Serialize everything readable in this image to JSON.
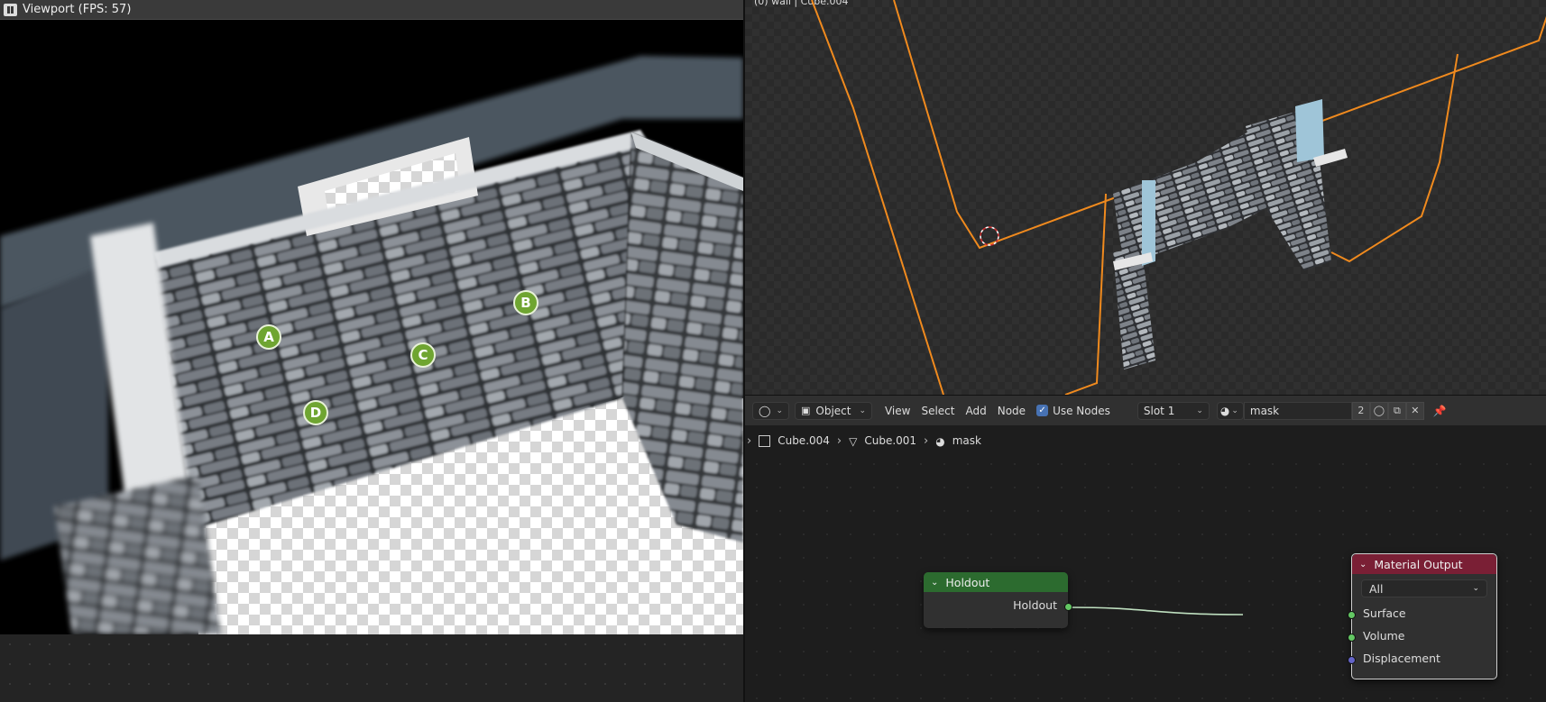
{
  "left_viewport": {
    "title": "Viewport (FPS: 57)",
    "markers": [
      {
        "label": "A"
      },
      {
        "label": "B"
      },
      {
        "label": "C"
      },
      {
        "label": "D"
      }
    ]
  },
  "viewport3d": {
    "info_text": "(0) wall | Cube.004"
  },
  "node_editor_header": {
    "mode": "Object",
    "menu": [
      "View",
      "Select",
      "Add",
      "Node"
    ],
    "use_nodes_label": "Use Nodes",
    "use_nodes_checked": true,
    "slot": "Slot 1",
    "material_name": "mask",
    "user_count": "2"
  },
  "breadcrumb": [
    "Cube.004",
    "Cube.001",
    "mask"
  ],
  "nodes": {
    "holdout": {
      "title": "Holdout",
      "output": "Holdout",
      "header_color": "#2c6b2f"
    },
    "material_output": {
      "title": "Material Output",
      "target": "All",
      "inputs": [
        "Surface",
        "Volume",
        "Displacement"
      ],
      "header_color": "#7a1f35"
    }
  },
  "colors": {
    "selection_orange": "#f08a1e",
    "socket_green": "#63c763",
    "socket_purple": "#6363c7",
    "marker_green": "#6fa531"
  }
}
